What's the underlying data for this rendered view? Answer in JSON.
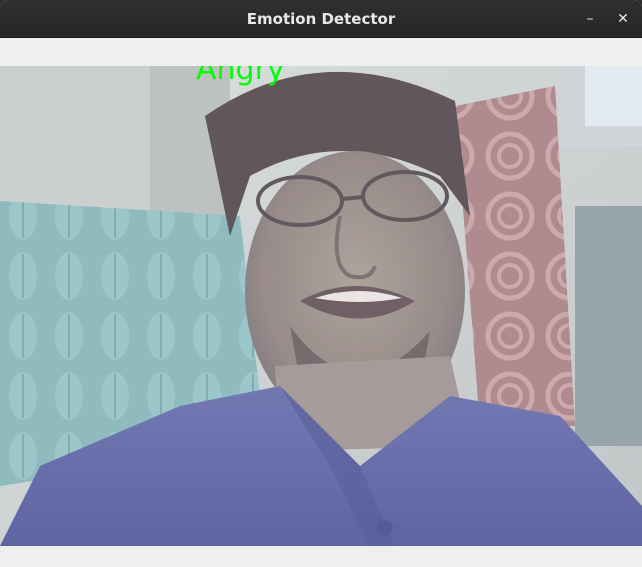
{
  "window": {
    "title": "Emotion Detector",
    "minimize_glyph": "–",
    "close_glyph": "✕"
  },
  "video": {
    "emotion_label": "Angry",
    "label_color": "#00ff00"
  },
  "icons": [
    "minimize-icon",
    "close-icon"
  ]
}
